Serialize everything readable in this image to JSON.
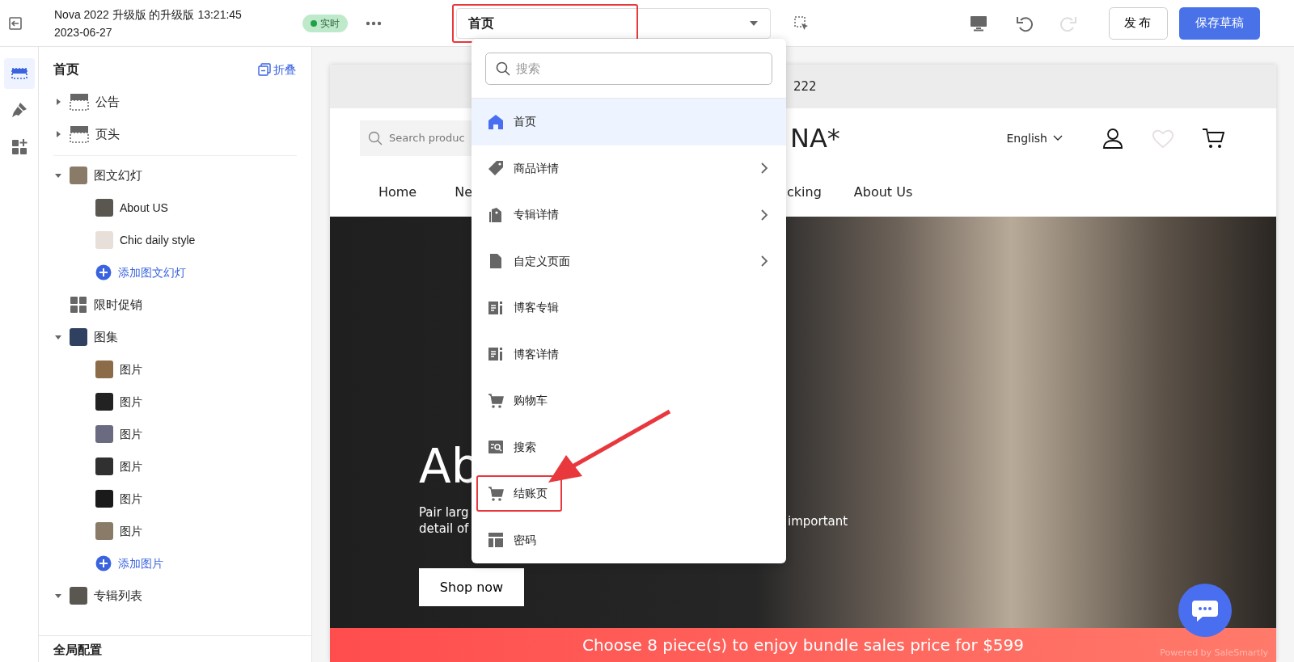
{
  "topbar": {
    "title_lines": [
      "Nova 2022 升级版 的升级版 13:21:45",
      "2023-06-27"
    ],
    "status_badge": "实时",
    "page_select": {
      "value": "首页",
      "annotated": true
    },
    "redo_disabled": true,
    "buttons": [
      {
        "label": "发布",
        "kind": "secondary"
      },
      {
        "label": "保存草稿",
        "kind": "primary"
      }
    ]
  },
  "rail": [
    {
      "kind": "sections",
      "selected": true
    },
    {
      "kind": "brush",
      "selected": false
    },
    {
      "kind": "apps",
      "selected": false
    }
  ],
  "sidebar": {
    "title": "首页",
    "collapse_label": "折叠",
    "fixed_sections": [
      {
        "kind": "section",
        "label": "公告",
        "expanded": false
      },
      {
        "kind": "section",
        "label": "页头",
        "expanded": false
      }
    ],
    "sections": [
      {
        "kind": "thumb",
        "label": "图文幻灯",
        "expanded": true,
        "children": [
          {
            "label": "About US"
          },
          {
            "label": "Chic daily style"
          }
        ],
        "add_label": "添加图文幻灯"
      },
      {
        "kind": "grid",
        "label": "限时促销"
      },
      {
        "kind": "thumb",
        "label": "图集",
        "expanded": true,
        "children": [
          {
            "label": "图片"
          },
          {
            "label": "图片"
          },
          {
            "label": "图片"
          },
          {
            "label": "图片"
          },
          {
            "label": "图片"
          },
          {
            "label": "图片"
          }
        ],
        "add_label": "添加图片"
      },
      {
        "kind": "thumb",
        "label": "专辑列表",
        "expanded": true
      }
    ],
    "footer": "全局配置"
  },
  "page_menu": {
    "search_placeholder": "搜索",
    "items": [
      {
        "kind": "home",
        "label": "首页",
        "submenu": false,
        "selected": true,
        "annotated": false
      },
      {
        "kind": "tag",
        "label": "商品详情",
        "submenu": true,
        "selected": false,
        "annotated": false
      },
      {
        "kind": "tags",
        "label": "专辑详情",
        "submenu": true,
        "selected": false,
        "annotated": false
      },
      {
        "kind": "file",
        "label": "自定义页面",
        "submenu": true,
        "selected": false,
        "annotated": false
      },
      {
        "kind": "blog",
        "label": "博客专辑",
        "submenu": false,
        "selected": false,
        "annotated": false
      },
      {
        "kind": "blog",
        "label": "博客详情",
        "submenu": false,
        "selected": false,
        "annotated": false
      },
      {
        "kind": "cart",
        "label": "购物车",
        "submenu": false,
        "selected": false,
        "annotated": false
      },
      {
        "kind": "search",
        "label": "搜索",
        "submenu": false,
        "selected": false,
        "annotated": false
      },
      {
        "kind": "cart",
        "label": "结账页",
        "submenu": false,
        "selected": false,
        "annotated": true
      },
      {
        "kind": "layout",
        "label": "密码",
        "submenu": false,
        "selected": false,
        "annotated": false
      }
    ]
  },
  "preview": {
    "announcement": "222",
    "search_placeholder": "Search produc",
    "logo": "NA*",
    "language": "English",
    "nav_before_menu": [
      "Home",
      "Ne"
    ],
    "nav_after_menu": [
      "cking",
      "About Us"
    ],
    "hero": {
      "heading": "Ab",
      "text_lines": [
        "Pair larg",
        "detail of"
      ],
      "text_right": "important",
      "button": "Shop now"
    },
    "promo_bar": "Choose 8 piece(s) to enjoy bundle sales price for $599",
    "powered_by": "Powered by SaleSmartly"
  }
}
